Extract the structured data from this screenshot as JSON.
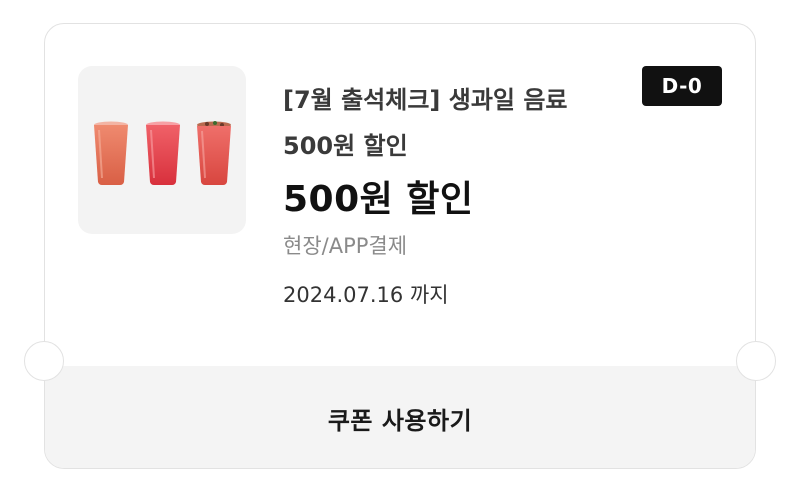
{
  "coupon": {
    "title": "[7월 출석체크] 생과일 음료",
    "subtitle": "500원 할인",
    "discount": "500원 할인",
    "payment_method": "현장/APP결제",
    "expiry": "2024.07.16 까지",
    "dday_badge": "D-0",
    "use_button_label": "쿠폰 사용하기",
    "image_icon": "fruit-juice-cups-icon"
  },
  "colors": {
    "badge_bg": "#111111",
    "footer_bg": "#f4f4f4",
    "muted_text": "#8a8a8a"
  }
}
